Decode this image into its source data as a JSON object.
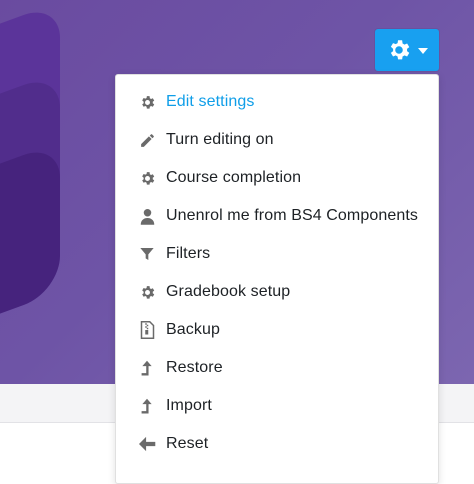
{
  "header": {
    "settings_button_icon": "gear-icon",
    "dropdown_icon": "caret-down-icon"
  },
  "menu": {
    "items": [
      {
        "label": "Edit settings",
        "icon": "gear-icon",
        "active": true
      },
      {
        "label": "Turn editing on",
        "icon": "pencil-icon"
      },
      {
        "label": "Course completion",
        "icon": "gear-icon"
      },
      {
        "label": "Unenrol me from BS4 Components",
        "icon": "user-icon"
      },
      {
        "label": "Filters",
        "icon": "filter-icon"
      },
      {
        "label": "Gradebook setup",
        "icon": "gear-icon"
      },
      {
        "label": "Backup",
        "icon": "file-archive-icon"
      },
      {
        "label": "Restore",
        "icon": "level-up-icon"
      },
      {
        "label": "Import",
        "icon": "level-up-icon"
      },
      {
        "label": "Reset",
        "icon": "arrow-left-icon"
      }
    ]
  },
  "colors": {
    "accent": "#18a0f0",
    "active_text": "#0f9ee8",
    "hero": "#6e54a6",
    "icon": "#6a6a6a"
  }
}
